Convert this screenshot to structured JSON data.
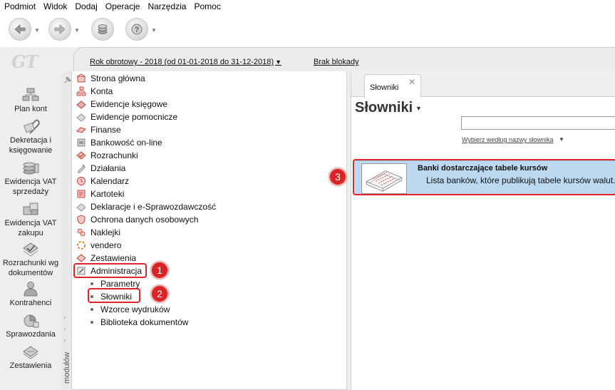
{
  "menubar": {
    "items": [
      "Podmiot",
      "Widok",
      "Dodaj",
      "Operacje",
      "Narzędzia",
      "Pomoc"
    ]
  },
  "toolbar": {
    "buttons": [
      {
        "icon": "back-arrow-icon"
      },
      {
        "icon": "forward-arrow-icon"
      },
      {
        "icon": "coins-icon"
      },
      {
        "icon": "help-icon"
      }
    ]
  },
  "sidebar": {
    "logo": "GT",
    "items": [
      {
        "label": "Plan kont",
        "icon": "chart-of-accounts-icon"
      },
      {
        "label": "Dekretacja i księgowanie",
        "icon": "paperclip-icon"
      },
      {
        "label": "Ewidencja VAT sprzedaży",
        "icon": "coins-stack-icon"
      },
      {
        "label": "Ewidencja VAT zakupu",
        "icon": "boxes-icon"
      },
      {
        "label": "Rozrachunki wg dokumentów",
        "icon": "settlements-icon"
      },
      {
        "label": "Kontrahenci",
        "icon": "person-icon"
      },
      {
        "label": "Sprawozdania",
        "icon": "reports-icon"
      },
      {
        "label": "Zestawienia",
        "icon": "summary-icon"
      }
    ]
  },
  "module_strip": {
    "label": "modułów"
  },
  "header": {
    "fiscal_year": "Rok obrotowy - 2018  (od 01-01-2018 do 31-12-2018)",
    "lock_status": "Brak blokady"
  },
  "tree": {
    "items": [
      {
        "label": "Strona główna",
        "icon": "home-icon",
        "color": "#c0392b"
      },
      {
        "label": "Konta",
        "icon": "accounts-icon",
        "color": "#c0392b"
      },
      {
        "label": "Ewidencje księgowe",
        "icon": "ledger-icon",
        "color": "#b03a3a"
      },
      {
        "label": "Ewidencje pomocnicze",
        "icon": "auxiliary-ledger-icon",
        "color": "#8a8a8a"
      },
      {
        "label": "Finanse",
        "icon": "finance-icon",
        "color": "#c0392b"
      },
      {
        "label": "Bankowość on-line",
        "icon": "bank-icon",
        "color": "#7a7a7a"
      },
      {
        "label": "Rozrachunki",
        "icon": "settlements-icon",
        "color": "#c0392b"
      },
      {
        "label": "Działania",
        "icon": "actions-icon",
        "color": "#a9a9a9"
      },
      {
        "label": "Kalendarz",
        "icon": "calendar-icon",
        "color": "#c0392b"
      },
      {
        "label": "Kartoteki",
        "icon": "records-icon",
        "color": "#c0392b"
      },
      {
        "label": "Deklaracje i e-Sprawozdawczość",
        "icon": "declarations-icon",
        "color": "#8a8a8a"
      },
      {
        "label": "Ochrona danych osobowych",
        "icon": "data-protection-icon",
        "color": "#c0392b"
      },
      {
        "label": "Naklejki",
        "icon": "stickers-icon",
        "color": "#c0392b"
      },
      {
        "label": "vendero",
        "icon": "vendero-icon",
        "color": "#e07b2b"
      },
      {
        "label": "Zestawienia",
        "icon": "summary-icon",
        "color": "#c0392b"
      },
      {
        "label": "Administracja",
        "icon": "administration-icon",
        "color": "#7a7a7a"
      }
    ],
    "sub_items": [
      "Parametry",
      "Słowniki",
      "Wzorce wydruków",
      "Biblioteka dokumentów"
    ]
  },
  "annotations": {
    "badge_1": "1",
    "badge_2": "2",
    "badge_3": "3",
    "color": "#e0252b"
  },
  "right_panel": {
    "tab_label": "Słowniki",
    "tab_close": "✕",
    "title": "Słowniki",
    "search_caption": "Wybierz według nazwy słownika",
    "search_value": "",
    "dictionary_items": [
      {
        "title": "Banki dostarczające tabele kursów",
        "description": "Lista banków, które publikują tabele kursów walut.",
        "icon": "exchange-rate-tables-icon"
      }
    ]
  },
  "colors": {
    "accent_red": "#e0252b",
    "selection_blue": "#bcd9f0",
    "panel_bg": "#eeeeee"
  }
}
